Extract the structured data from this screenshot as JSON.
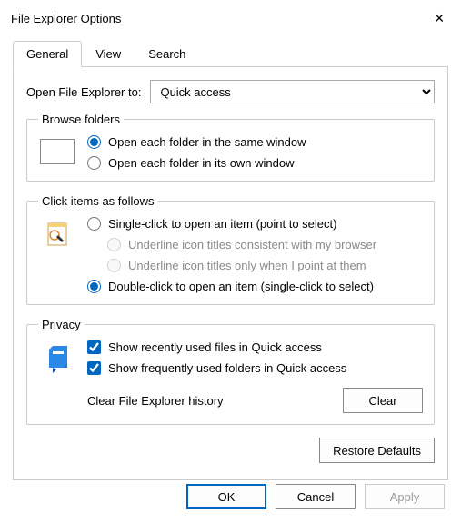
{
  "title": "File Explorer Options",
  "tabs": {
    "general": "General",
    "view": "View",
    "search": "Search"
  },
  "open_to": {
    "label": "Open File Explorer to:",
    "value": "Quick access"
  },
  "browse": {
    "legend": "Browse folders",
    "same": "Open each folder in the same window",
    "own": "Open each folder in its own window"
  },
  "click": {
    "legend": "Click items as follows",
    "single": "Single-click to open an item (point to select)",
    "underline_browser": "Underline icon titles consistent with my browser",
    "underline_point": "Underline icon titles only when I point at them",
    "double": "Double-click to open an item (single-click to select)"
  },
  "privacy": {
    "legend": "Privacy",
    "recent_files": "Show recently used files in Quick access",
    "frequent_folders": "Show frequently used folders in Quick access",
    "clear_label": "Clear File Explorer history",
    "clear_btn": "Clear"
  },
  "restore": "Restore Defaults",
  "buttons": {
    "ok": "OK",
    "cancel": "Cancel",
    "apply": "Apply"
  }
}
